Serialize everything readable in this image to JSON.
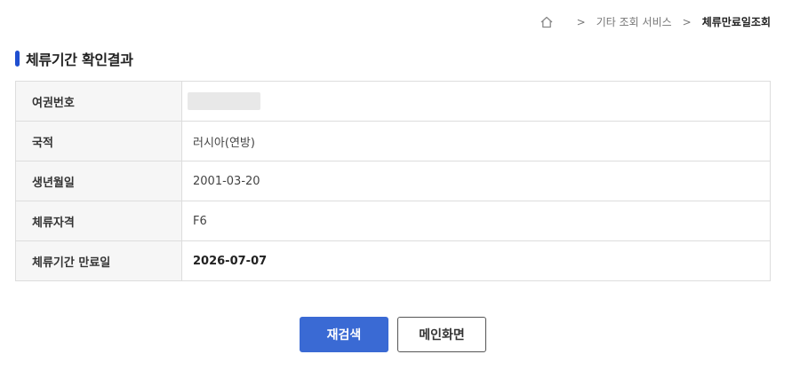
{
  "breadcrumb": {
    "home_icon": "home-icon",
    "items": [
      "기타 조회 서비스",
      "체류만료일조회"
    ]
  },
  "page_title": "체류기간 확인결과",
  "rows": [
    {
      "label": "여권번호",
      "value": ""
    },
    {
      "label": "국적",
      "value": "러시아(연방)"
    },
    {
      "label": "생년월일",
      "value": "2001-03-20"
    },
    {
      "label": "체류자격",
      "value": "F6"
    },
    {
      "label": "체류기간 만료일",
      "value": "2026-07-07"
    }
  ],
  "buttons": {
    "research_label": "재검색",
    "main_label": "메인화면"
  },
  "colors": {
    "accent": "#3a6ad4",
    "title_bar": "#1f4fd0"
  }
}
